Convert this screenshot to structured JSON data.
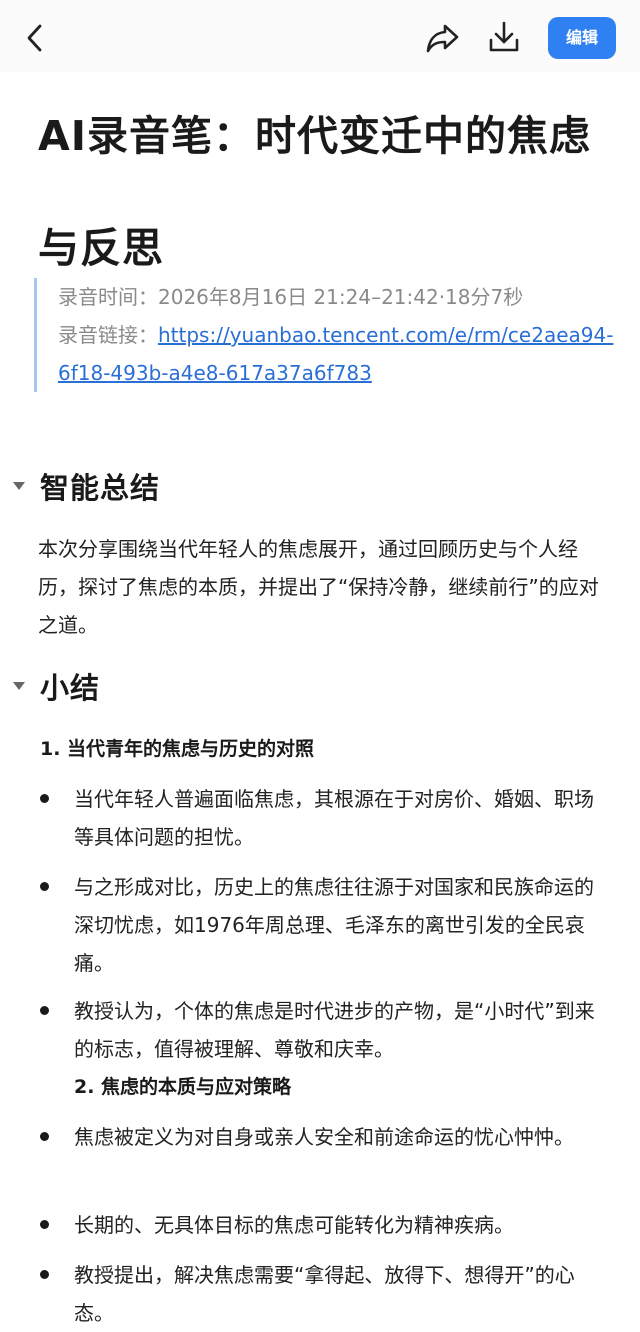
{
  "toolbar": {
    "edit_label": "编辑"
  },
  "icons": [
    "chevron-left-icon",
    "share-icon",
    "download-icon",
    "caret-down-icon"
  ],
  "colors": {
    "accent": "#2f80f2",
    "link": "#2a6fd6",
    "meta_text": "#8a8a8a",
    "quote_bar": "#a8c7ee"
  },
  "document": {
    "title": "AI录音笔：时代变迁中的焦虑与反思",
    "meta": {
      "time_label": "录音时间：",
      "time_value": "2026年8月16日 21:24–21:42·18分7秒",
      "link_label": "录音链接：",
      "link_url": "https://yuanbao.tencent.com/e/rm/ce2aea94-6f18-493b-a4e8-617a37a6f783"
    },
    "summary": {
      "heading": "智能总结",
      "text": "本次分享围绕当代年轻人的焦虑展开，通过回顾历史与个人经历，探讨了焦虑的本质，并提出了“保持冷静，继续前行”的应对之道。"
    },
    "recap": {
      "heading": "小结",
      "sections": [
        {
          "title": "1. 当代青年的焦虑与历史的对照",
          "bullets": [
            "当代年轻人普遍面临焦虑，其根源在于对房价、婚姻、职场等具体问题的担忧。",
            "与之形成对比，历史上的焦虑往往源于对国家和民族命运的深切忧虑，如1976年周总理、毛泽东的离世引发的全民哀痛。",
            "教授认为，个体的焦虑是时代进步的产物，是“小时代”到来的标志，值得被理解、尊敬和庆幸。"
          ]
        },
        {
          "title": "2. 焦虑的本质与应对策略",
          "bullets": [
            "焦虑被定义为对自身或亲人安全和前途命运的忧心忡忡。",
            "长期的、无具体目标的焦虑可能转化为精神疾病。",
            "教授提出，解决焦虑需要“拿得起、放得下、想得开”的心态。"
          ]
        }
      ]
    }
  }
}
